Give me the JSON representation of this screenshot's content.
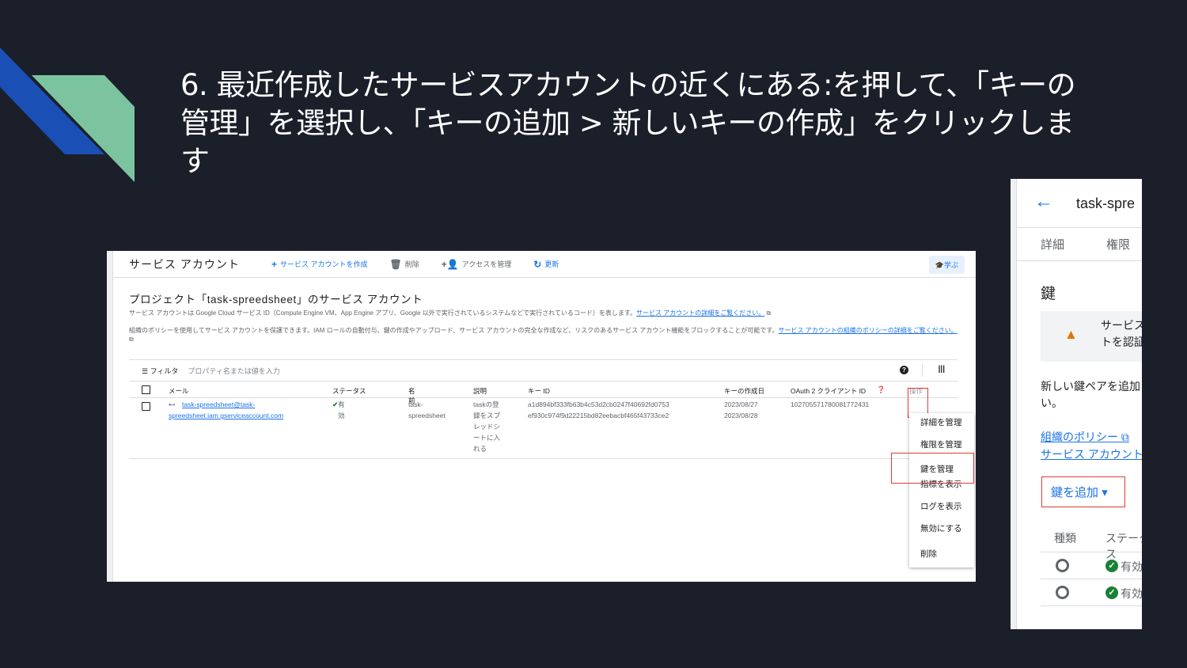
{
  "slide": {
    "title": "6. 最近作成したサービスアカウントの近くにある:を押して、「キーの管理」を選択し、「キーの追加 > 新しいキーの作成」をクリックします"
  },
  "console": {
    "page_title": "サービス アカウント",
    "toolbar": {
      "create": "サービス アカウントを作成",
      "delete": "削除",
      "manage_access": "アクセスを管理",
      "refresh": "更新",
      "learn": "学ぶ"
    },
    "section_title": "プロジェクト「task-spreedsheet」のサービス アカウント",
    "desc1": "サービス アカウントは Google Cloud サービス ID（Compute Engine VM、App Engine アプリ、Google 以外で実行されているシステムなどで実行されているコード）を表します。",
    "desc1_link": "サービス アカウントの詳細をご覧ください。",
    "desc2": "組織のポリシーを使用してサービス アカウントを保護できます。IAM ロールの自動付与、鍵の作成やアップロード、サービス アカウントの完全な作成など、リスクのあるサービス アカウント機能をブロックすることが可能です。",
    "desc2_link": "サービス アカウントの組織のポリシーの詳細をご覧ください。",
    "filter": {
      "label": "フィルタ",
      "placeholder": "プロパティ名または値を入力"
    },
    "columns": {
      "email": "メール",
      "status": "ステータス",
      "name": "名前",
      "description": "説明",
      "key_id": "キー ID",
      "key_created": "キーの作成日",
      "oauth": "OAuth 2 クライアント ID",
      "actions": "操作"
    },
    "row": {
      "email_1": "task-spreedsheet@task-",
      "email_2": "spreedsheet.iam.gserviceaccount.com",
      "status": "有効",
      "name_1": "task-",
      "name_2": "spreedsheet",
      "desc_lines": [
        "taskの登",
        "録をスプ",
        "レッドシ",
        "ートに入",
        "れる"
      ],
      "key_id_1": "a1d894bf333fb63b4c53d2cb0247f40692fd0753",
      "key_id_2": "ef930c974f9d22215bd82eebacbf465f43733ce2",
      "date_1": "2023/08/27",
      "date_2": "2023/08/28",
      "oauth_id": "102705571780081772431"
    },
    "menu": {
      "details": "詳細を管理",
      "permissions": "権限を管理",
      "keys": "鍵を管理",
      "metrics": "指標を表示",
      "logs": "ログを表示",
      "disable": "無効にする",
      "delete": "削除"
    }
  },
  "side_panel": {
    "title": "task-spre",
    "tabs": [
      "詳細",
      "権限"
    ],
    "heading": "鍵",
    "warning_1": "サービス",
    "warning_2": "トを認証",
    "new_key_1": "新しい鍵ペアを追加",
    "new_key_2": "い。",
    "org_policy": "組織のポリシー",
    "sa_link": "サービス アカウント",
    "add_key": "鍵を追加",
    "col_type": "種類",
    "col_status": "ステータス",
    "rows": [
      {
        "status": "有効"
      },
      {
        "status": "有効"
      }
    ]
  },
  "colors": {
    "background": "#1b1f2a",
    "accent_blue": "#1a73e8",
    "highlight": "#e53935",
    "deco_blue": "#1a4fb5",
    "deco_green": "#7cc4a0"
  }
}
